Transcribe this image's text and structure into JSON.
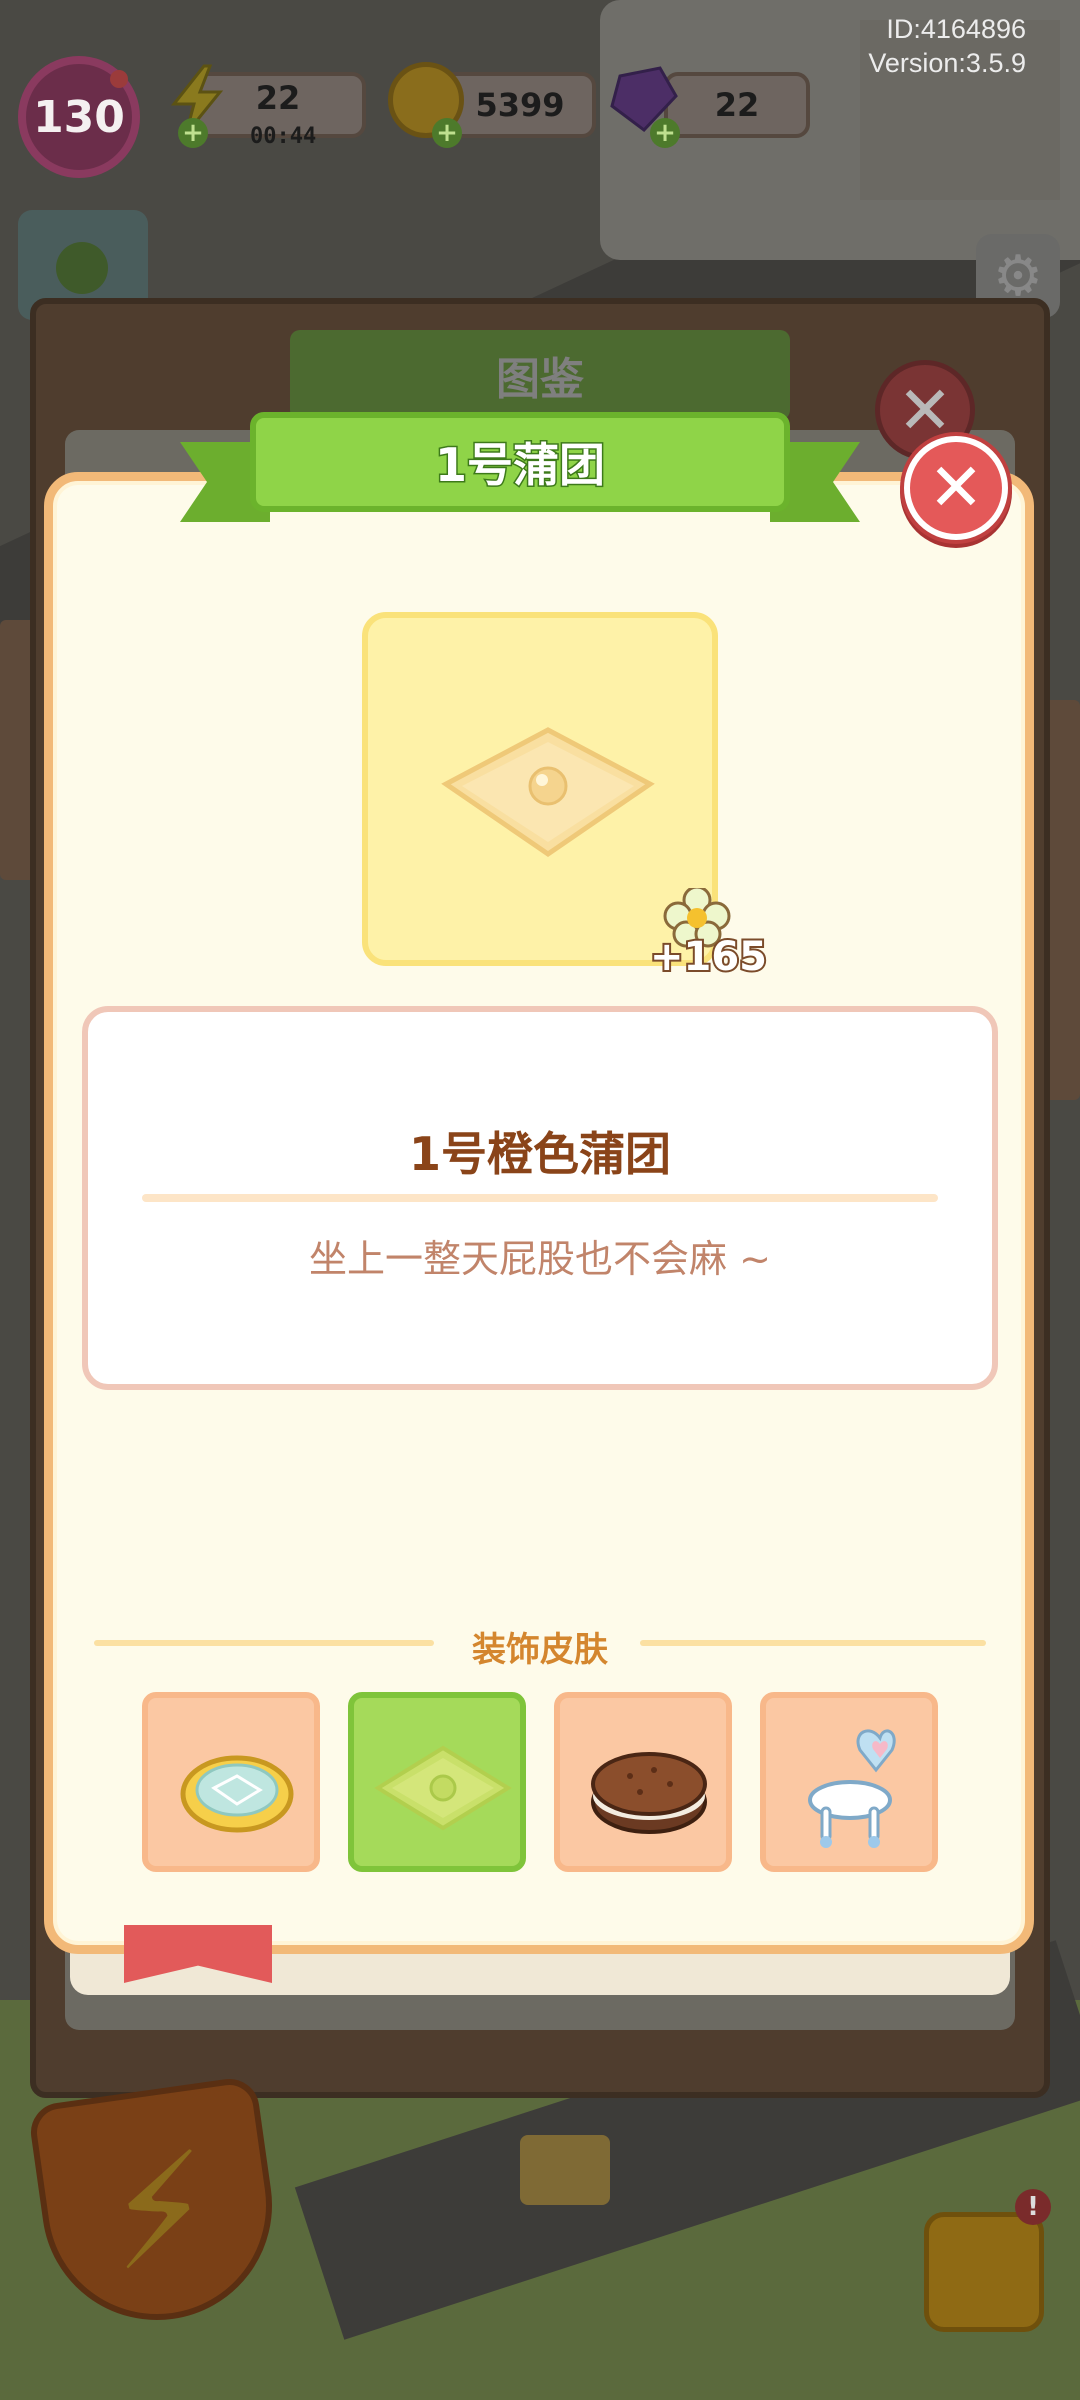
{
  "meta": {
    "user_id": "ID:4164896",
    "version": "Version:3.5.9"
  },
  "hud": {
    "level": "130",
    "energy": "22",
    "energy_timer": "00:44",
    "coins": "5399",
    "gems": "22"
  },
  "background_catalog": {
    "title": "图鉴"
  },
  "modal": {
    "title": "1号蒲团",
    "close_icon": "close-icon",
    "reward_value": "+165",
    "item_name": "1号橙色蒲团",
    "item_description": "坐上一整天屁股也不会麻 ~",
    "skins_title": "装饰皮肤",
    "skins": [
      {
        "name": "round-glass-cushion",
        "selected": false
      },
      {
        "name": "square-cushion",
        "selected": true
      },
      {
        "name": "chocolate-cookie-cushion",
        "selected": false
      },
      {
        "name": "heart-back-stool",
        "selected": false
      }
    ]
  },
  "colors": {
    "ribbon_green": "#8fd448",
    "modal_bg": "#fefbea",
    "modal_border": "#f2b978",
    "close_red": "#e45959",
    "item_name_brown": "#8a4419",
    "description_color": "#c1846a",
    "skins_title_color": "#d4862e"
  }
}
